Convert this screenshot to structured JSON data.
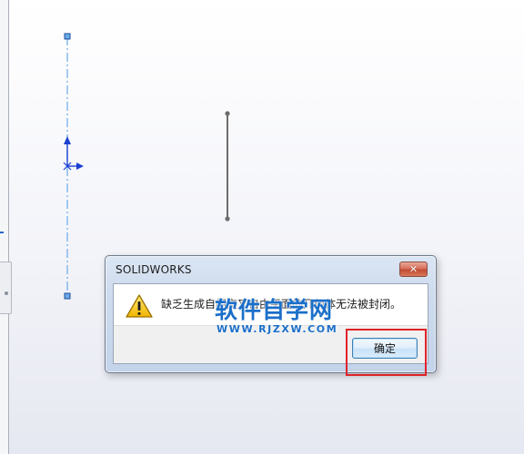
{
  "dialog": {
    "title": "SOLIDWORKS",
    "close_glyph": "✕",
    "icon": "warning-icon",
    "message": "缺乏生成自相交叉自由平面的几何体无法被封闭。",
    "message_visible_part1": "缺乏生成自相",
    "message_visible_part2": "无法被封闭。",
    "ok_label": "确定"
  },
  "watermark": {
    "main": "软件自学网",
    "sub": "WWW.RJZXW.COM"
  },
  "colors": {
    "construction_line": "#6aa9e8",
    "sketch_entity": "#6d6d6d",
    "annotation_box": "#e0222a",
    "watermark": "#1b6fc9"
  }
}
